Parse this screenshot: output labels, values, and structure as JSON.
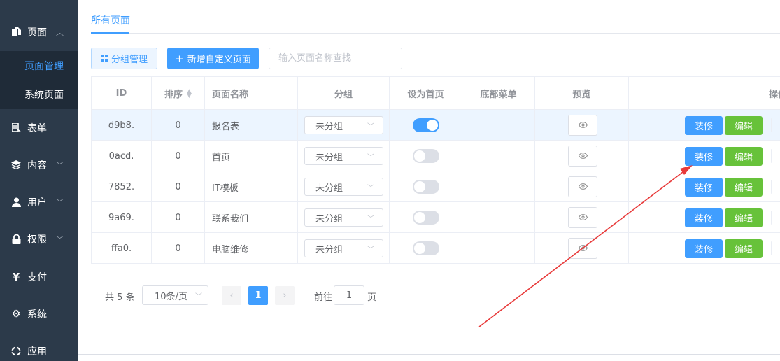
{
  "sidebar": {
    "items": [
      {
        "name": "pages",
        "label": "页面",
        "icon": "pages-icon",
        "chevron": "up"
      },
      {
        "name": "forms",
        "label": "表单",
        "icon": "form-icon",
        "chevron": ""
      },
      {
        "name": "content",
        "label": "内容",
        "icon": "layers-icon",
        "chevron": "down"
      },
      {
        "name": "users",
        "label": "用户",
        "icon": "user-icon",
        "chevron": "down"
      },
      {
        "name": "permissions",
        "label": "权限",
        "icon": "lock-icon",
        "chevron": "down"
      },
      {
        "name": "payment",
        "label": "支付",
        "icon": "yen-icon",
        "chevron": ""
      },
      {
        "name": "system",
        "label": "系统",
        "icon": "gear-icon",
        "chevron": ""
      },
      {
        "name": "apps",
        "label": "应用",
        "icon": "app-icon",
        "chevron": ""
      }
    ],
    "submenu": [
      {
        "label": "页面管理",
        "active": true
      },
      {
        "label": "系统页面",
        "active": false
      }
    ]
  },
  "tabs": {
    "active_label": "所有页面"
  },
  "toolbar": {
    "group_label": "分组管理",
    "add_label": "新增自定义页面",
    "search_placeholder": "输入页面名称查找"
  },
  "table": {
    "headers": {
      "id": "ID",
      "sort": "排序",
      "name": "页面名称",
      "group": "分组",
      "home": "设为首页",
      "bottom_menu": "底部菜单",
      "preview": "预览",
      "ops": "操作"
    },
    "rows": [
      {
        "id": "d9b8.",
        "sort": "0",
        "name": "报名表",
        "group": "未分组",
        "home": true,
        "decorate": "装修",
        "edit": "编辑"
      },
      {
        "id": "0acd.",
        "sort": "0",
        "name": "首页",
        "group": "未分组",
        "home": false,
        "decorate": "装修",
        "edit": "编辑"
      },
      {
        "id": "7852.",
        "sort": "0",
        "name": "IT模板",
        "group": "未分组",
        "home": false,
        "decorate": "装修",
        "edit": "编辑"
      },
      {
        "id": "9a69.",
        "sort": "0",
        "name": "联系我们",
        "group": "未分组",
        "home": false,
        "decorate": "装修",
        "edit": "编辑"
      },
      {
        "id": "ffa0.",
        "sort": "0",
        "name": "电脑维修",
        "group": "未分组",
        "home": false,
        "decorate": "装修",
        "edit": "编辑"
      }
    ]
  },
  "pagination": {
    "total": "共 5 条",
    "page_size": "10条/页",
    "current_page": "1",
    "goto_label": "前往",
    "goto_value": "1",
    "goto_suffix": "页"
  },
  "colors": {
    "primary": "#409eff",
    "success": "#67c23a",
    "sidebar": "#2c3a4a",
    "annotation": "#e83a3a"
  }
}
